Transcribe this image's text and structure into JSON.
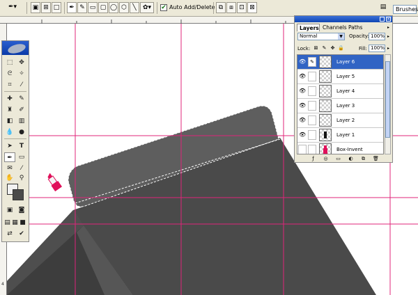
{
  "options_bar": {
    "auto_add_delete": {
      "checked": true,
      "label": "Auto Add/Delete"
    },
    "brushes_tab": "Brushes"
  },
  "rulers": {
    "left_tick": "4"
  },
  "canvas": {
    "guide_color": "#e0247a",
    "shape_colors": {
      "lid": "#5e5e5e",
      "front": "#4a4a4a",
      "side": "#3b3b3b",
      "light_face": "#7a7a7a"
    },
    "lipstick_color": "#e0105a"
  },
  "layers_panel": {
    "tabs": [
      "Layers",
      "Channels",
      "Paths"
    ],
    "active_tab": "Layers",
    "blend_mode": "Normal",
    "opacity_label": "Opacity:",
    "opacity": "100%",
    "lock_label": "Lock:",
    "fill_label": "Fill:",
    "fill": "100%",
    "layers": [
      {
        "name": "Layer 6",
        "selected": true,
        "visible": true
      },
      {
        "name": "Layer 5",
        "selected": false,
        "visible": true
      },
      {
        "name": "Layer 4",
        "selected": false,
        "visible": true
      },
      {
        "name": "Layer 3",
        "selected": false,
        "visible": true
      },
      {
        "name": "Layer 2",
        "selected": false,
        "visible": true
      },
      {
        "name": "Layer 1",
        "selected": false,
        "visible": true
      },
      {
        "name": "Box-Invent",
        "selected": false,
        "visible": false
      }
    ]
  }
}
